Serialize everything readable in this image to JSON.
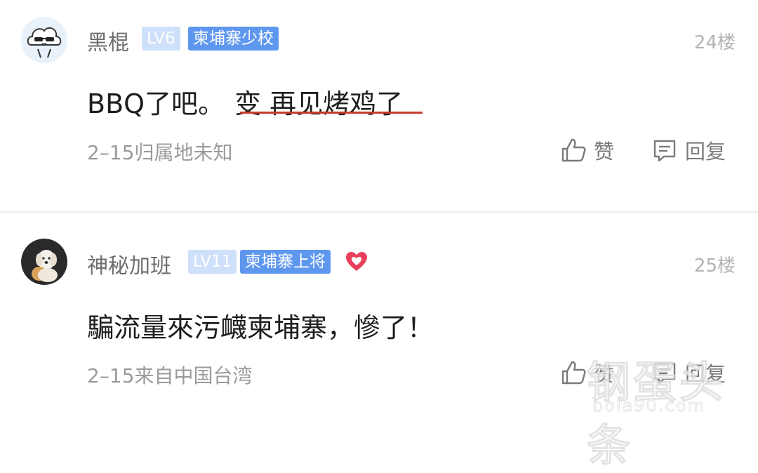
{
  "comments": [
    {
      "username": "黑棍",
      "level": "LV6",
      "title": "柬埔寨少校",
      "floor": "24楼",
      "content_prefix": "BBQ了吧。",
      "content_underlined": "变 再见烤鸡了",
      "meta": "2–15归属地未知",
      "like_label": "赞",
      "reply_label": "回复"
    },
    {
      "username": "神秘加班",
      "level": "LV11",
      "title": "柬埔寨上将",
      "floor": "25楼",
      "content": "騙流量來污衊柬埔寨，慘了！",
      "meta": "2–15来自中国台湾",
      "like_label": "赞",
      "reply_label": "回复"
    }
  ],
  "watermark": {
    "text": "钢蛋头条",
    "url": "bola90.com"
  },
  "colors": {
    "level_badge": "#cfe0fb",
    "title_badge": "#5e97ee",
    "underline": "#c83a2e",
    "heart": "#e8405a"
  }
}
